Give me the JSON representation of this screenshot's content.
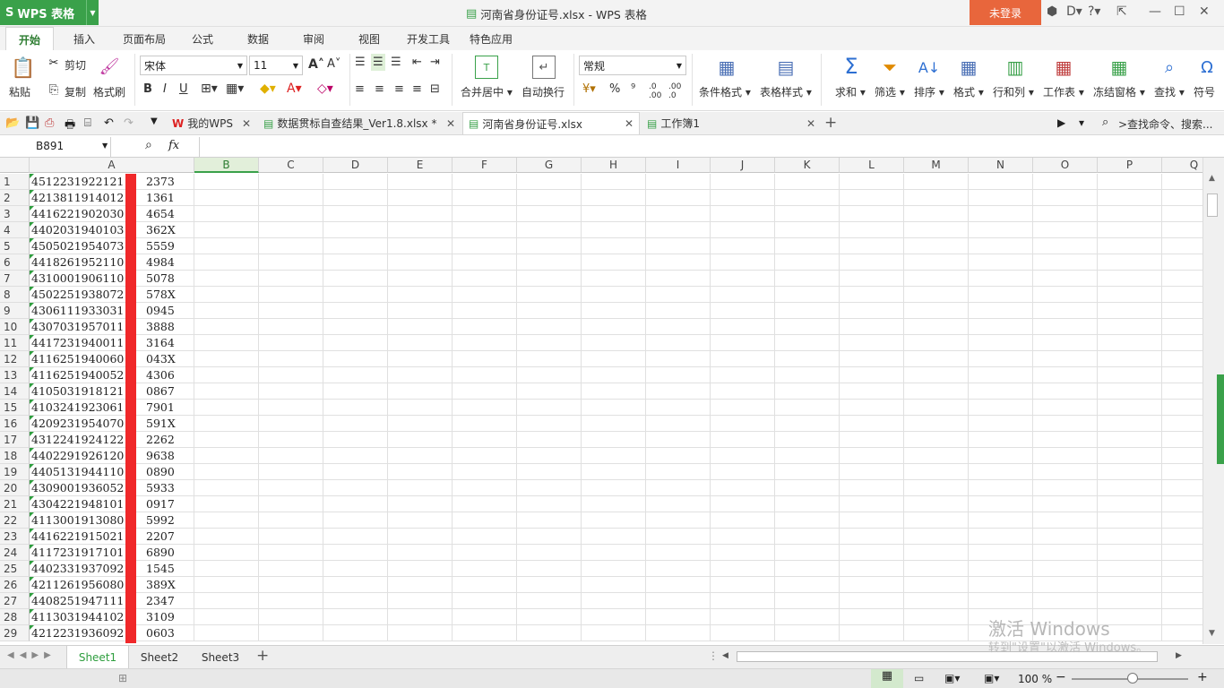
{
  "app": {
    "name": "WPS 表格",
    "window_title": "河南省身份证号.xlsx - WPS 表格",
    "login": "未登录",
    "accent": "#3aa14a",
    "login_color": "#e8663c"
  },
  "ribbon_tabs": [
    "开始",
    "插入",
    "页面布局",
    "公式",
    "数据",
    "审阅",
    "视图",
    "开发工具",
    "特色应用"
  ],
  "ribbon": {
    "paste": "粘贴",
    "cut": "剪切",
    "copy": "复制",
    "format_painter": "格式刷",
    "font_name": "宋体",
    "font_size": "11",
    "merge_center": "合并居中",
    "wrap_text": "自动换行",
    "number_format": "常规",
    "conditional_format": "条件格式",
    "table_style": "表格样式",
    "sum": "求和",
    "filter": "筛选",
    "sort": "排序",
    "format": "格式",
    "row_col": "行和列",
    "worksheet": "工作表",
    "freeze": "冻结窗格",
    "find": "查找",
    "symbol": "符号"
  },
  "doc_tabs": [
    {
      "label": "我的WPS",
      "active": false
    },
    {
      "label": "数据贯标自查结果_Ver1.8.xlsx *",
      "active": false
    },
    {
      "label": "河南省身份证号.xlsx",
      "active": true
    },
    {
      "label": "工作簿1",
      "active": false
    }
  ],
  "search_placeholder": ">查找命令、搜索...",
  "formula_bar": {
    "name_box": "B891",
    "fx": "fx"
  },
  "columns": [
    "A",
    "B",
    "C",
    "D",
    "E",
    "F",
    "G",
    "H",
    "I",
    "J",
    "K",
    "L",
    "M",
    "N",
    "O",
    "P",
    "Q"
  ],
  "rows": [
    {
      "n": "1",
      "a_left": "4512231922121",
      "a_right": "2373"
    },
    {
      "n": "2",
      "a_left": "4213811914012",
      "a_right": "1361"
    },
    {
      "n": "3",
      "a_left": "4416221902030",
      "a_right": "4654"
    },
    {
      "n": "4",
      "a_left": "4402031940103",
      "a_right": "362X"
    },
    {
      "n": "5",
      "a_left": "4505021954073",
      "a_right": "5559"
    },
    {
      "n": "6",
      "a_left": "4418261952110",
      "a_right": "4984"
    },
    {
      "n": "7",
      "a_left": "4310001906110",
      "a_right": "5078"
    },
    {
      "n": "8",
      "a_left": "4502251938072",
      "a_right": "578X"
    },
    {
      "n": "9",
      "a_left": "4306111933031",
      "a_right": "0945"
    },
    {
      "n": "10",
      "a_left": "4307031957011",
      "a_right": "3888"
    },
    {
      "n": "11",
      "a_left": "4417231940011",
      "a_right": "3164"
    },
    {
      "n": "12",
      "a_left": "4116251940060",
      "a_right": "043X"
    },
    {
      "n": "13",
      "a_left": "4116251940052",
      "a_right": "4306"
    },
    {
      "n": "14",
      "a_left": "4105031918121",
      "a_right": "0867"
    },
    {
      "n": "15",
      "a_left": "4103241923061",
      "a_right": "7901"
    },
    {
      "n": "16",
      "a_left": "4209231954070",
      "a_right": "591X"
    },
    {
      "n": "17",
      "a_left": "4312241924122",
      "a_right": "2262"
    },
    {
      "n": "18",
      "a_left": "4402291926120",
      "a_right": "9638"
    },
    {
      "n": "19",
      "a_left": "4405131944110",
      "a_right": "0890"
    },
    {
      "n": "20",
      "a_left": "4309001936052",
      "a_right": "5933"
    },
    {
      "n": "21",
      "a_left": "4304221948101",
      "a_right": "0917"
    },
    {
      "n": "22",
      "a_left": "4113001913080",
      "a_right": "5992"
    },
    {
      "n": "23",
      "a_left": "4416221915021",
      "a_right": "2207"
    },
    {
      "n": "24",
      "a_left": "4117231917101",
      "a_right": "6890"
    },
    {
      "n": "25",
      "a_left": "4402331937092",
      "a_right": "1545"
    },
    {
      "n": "26",
      "a_left": "4211261956080",
      "a_right": "389X"
    },
    {
      "n": "27",
      "a_left": "4408251947111",
      "a_right": "2347"
    },
    {
      "n": "28",
      "a_left": "4113031944102",
      "a_right": "3109"
    },
    {
      "n": "29",
      "a_left": "4212231936092",
      "a_right": "0603"
    }
  ],
  "sheets": [
    "Sheet1",
    "Sheet2",
    "Sheet3"
  ],
  "status": {
    "zoom": "100 %"
  },
  "watermark": {
    "line1": "激活 Windows",
    "line2": "转到\"设置\"以激活 Windows。"
  }
}
